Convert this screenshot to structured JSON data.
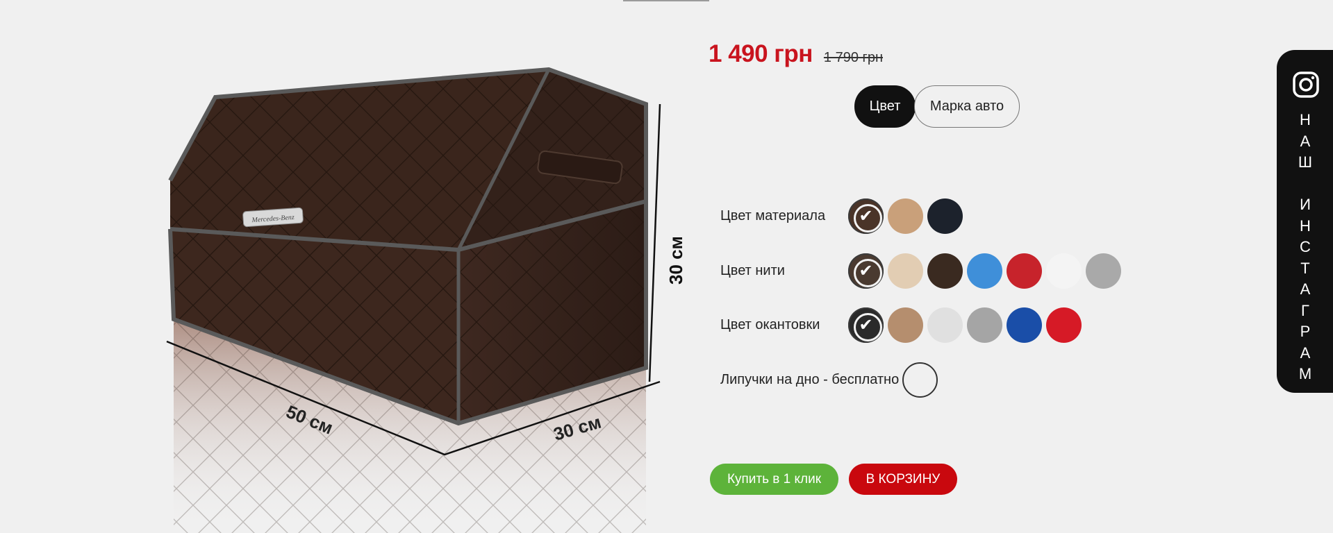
{
  "product": {
    "price": "1 490 грн",
    "old_price": "1 790 грн",
    "image_dimensions": [
      "50 см",
      "30 см",
      "30 см"
    ],
    "badge_text": "Mercedes-Benz"
  },
  "tabs": [
    {
      "label": "Цвет",
      "active": true
    },
    {
      "label": "Марка авто",
      "active": false
    }
  ],
  "options": {
    "material": {
      "label": "Цвет материала",
      "swatches": [
        "#4a3428",
        "#c9a07a",
        "#1c222c"
      ],
      "selected": 0
    },
    "thread": {
      "label": "Цвет нити",
      "swatches": [
        "#4a3a30",
        "#e2cdb3",
        "#3a2a20",
        "#3f8fd9",
        "#c7232b",
        "#f4f4f4",
        "#a9a9a9"
      ],
      "selected": 0
    },
    "edging": {
      "label": "Цвет окантовки",
      "swatches": [
        "#2a2a2a",
        "#b58e6e",
        "#e0e0e0",
        "#a5a5a5",
        "#1a4ea8",
        "#d61a26"
      ],
      "selected": 0
    },
    "velcro": {
      "label": "Липучки на дно - бесплатно"
    }
  },
  "buttons": {
    "quick_buy": "Купить в 1 клик",
    "add_to_cart": "В КОРЗИНУ"
  },
  "instagram": {
    "letters": [
      "Н",
      "А",
      "Ш",
      "",
      "И",
      "Н",
      "С",
      "Т",
      "А",
      "Г",
      "Р",
      "А",
      "М"
    ]
  },
  "colors": {
    "price": "#c9141e",
    "buy_green": "#5db33a",
    "cart_red": "#c9080e"
  }
}
